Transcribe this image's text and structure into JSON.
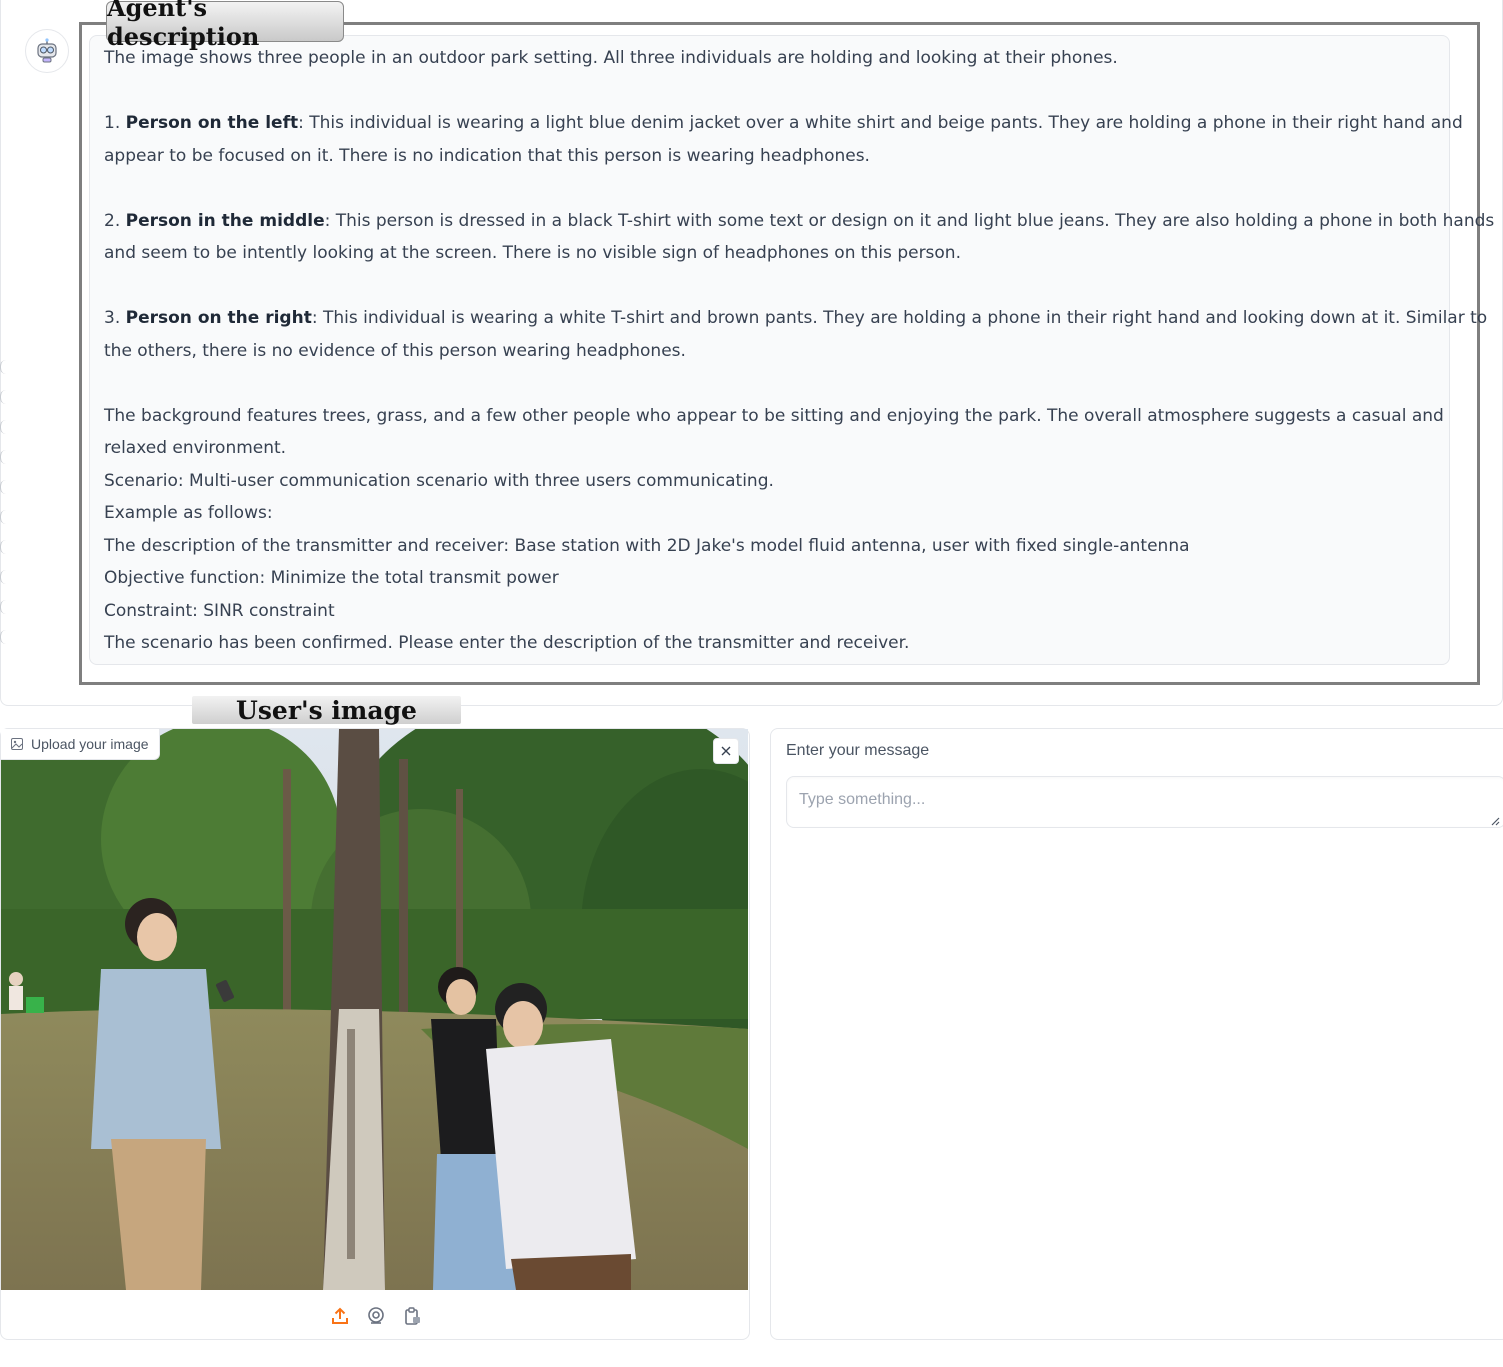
{
  "agent": {
    "label": "Agent's description",
    "intro": "The image shows three people in an outdoor park setting. All three individuals are holding and looking at their phones.",
    "person1": {
      "num": "1.",
      "name": "Person on the left",
      "line1": ": This individual is wearing a light blue denim jacket over a white shirt and beige pants. They are holding a phone in their right hand and",
      "line2": "appear to be focused on it. There is no indication that this person is wearing headphones."
    },
    "person2": {
      "num": "2.",
      "name": "Person in the middle",
      "line1": ": This person is dressed in a black T-shirt with some text or design on it and light blue jeans. They are also holding a phone in both hands",
      "line2": "and seem to be intently looking at the screen. There is no visible sign of headphones on this person."
    },
    "person3": {
      "num": "3.",
      "name": "Person on the right",
      "line1": ": This individual is wearing a white T-shirt and brown pants. They are holding a phone in their right hand and looking down at it. Similar to",
      "line2": "the others, there is no evidence of this person wearing headphones."
    },
    "background_line1": "The background features trees, grass, and a few other people who appear to be sitting and enjoying the park. The overall atmosphere suggests a casual and",
    "background_line2": "relaxed environment.",
    "scenario": "Scenario: Multi-user communication scenario with three users communicating.",
    "example": "Example as follows:",
    "transceiver": "The description of the transmitter and receiver: Base station with 2D Jake's model fluid antenna, user with fixed single-antenna",
    "objective": "Objective function: Minimize the total transmit power",
    "constraint": "Constraint: SINR constraint",
    "confirmed": "The scenario has been confirmed. Please enter the description of the transmitter and receiver."
  },
  "image_panel": {
    "label": "User's image",
    "upload_badge": "Upload your image"
  },
  "message_panel": {
    "label": "Enter your message",
    "placeholder": "Type something..."
  },
  "colors": {
    "accent": "#f97316",
    "frame": "#7f7f7f",
    "message_bg": "#f9fafb"
  },
  "icons": [
    "robot-avatar-icon",
    "image-icon",
    "close-icon",
    "upload-icon",
    "webcam-icon",
    "clipboard-icon"
  ]
}
